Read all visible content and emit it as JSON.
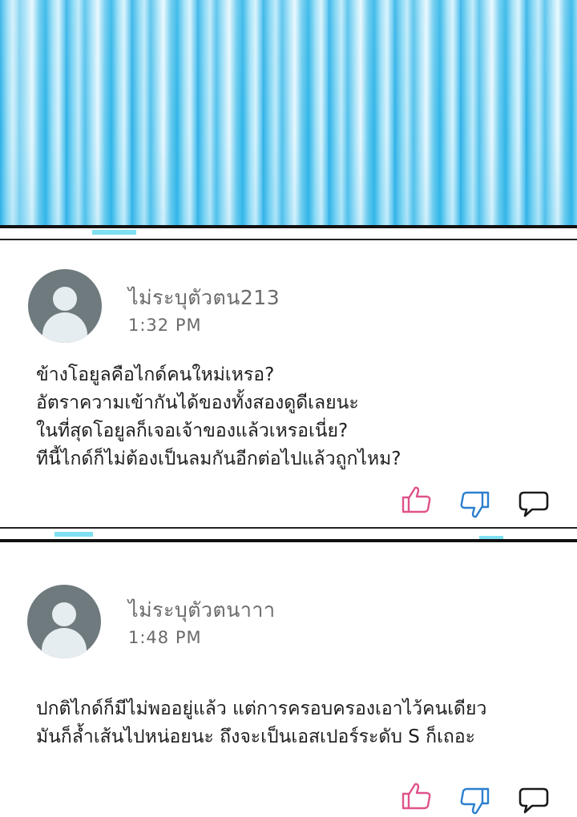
{
  "colors": {
    "like": "#e0528a",
    "dislike": "#2b7fcf",
    "reply": "#1a1a1a",
    "accent_cyan": "#7fe0f2"
  },
  "comments": [
    {
      "author": "ไม่ระบุตัวตน213",
      "time": "1:32 PM",
      "text": "ข้างโอยูลคือไกด์คนใหม่เหรอ?\nอัตราความเข้ากันได้ของทั้งสองดูดีเลยนะ\nในที่สุดโอยูลก็เจอเจ้าของแล้วเหรอเนี่ย?\nทีนี้ไกด์ก็ไม่ต้องเป็นลมกันอีกต่อไปแล้วถูกไหม?",
      "icons": {
        "like": "thumbs-up-icon",
        "dislike": "thumbs-down-icon",
        "reply": "speech-bubble-icon"
      }
    },
    {
      "author": "ไม่ระบุตัวตนาาา",
      "time": "1:48 PM",
      "text": "ปกติไกด์ก็มีไม่พออยู่แล้ว แต่การครอบครองเอาไว้คนเดียว\nมันก็ล้ำเส้นไปหน่อยนะ ถึงจะเป็นเอสเปอร์ระดับ S ก็เถอะ",
      "icons": {
        "like": "thumbs-up-icon",
        "dislike": "thumbs-down-icon",
        "reply": "speech-bubble-icon"
      }
    }
  ]
}
